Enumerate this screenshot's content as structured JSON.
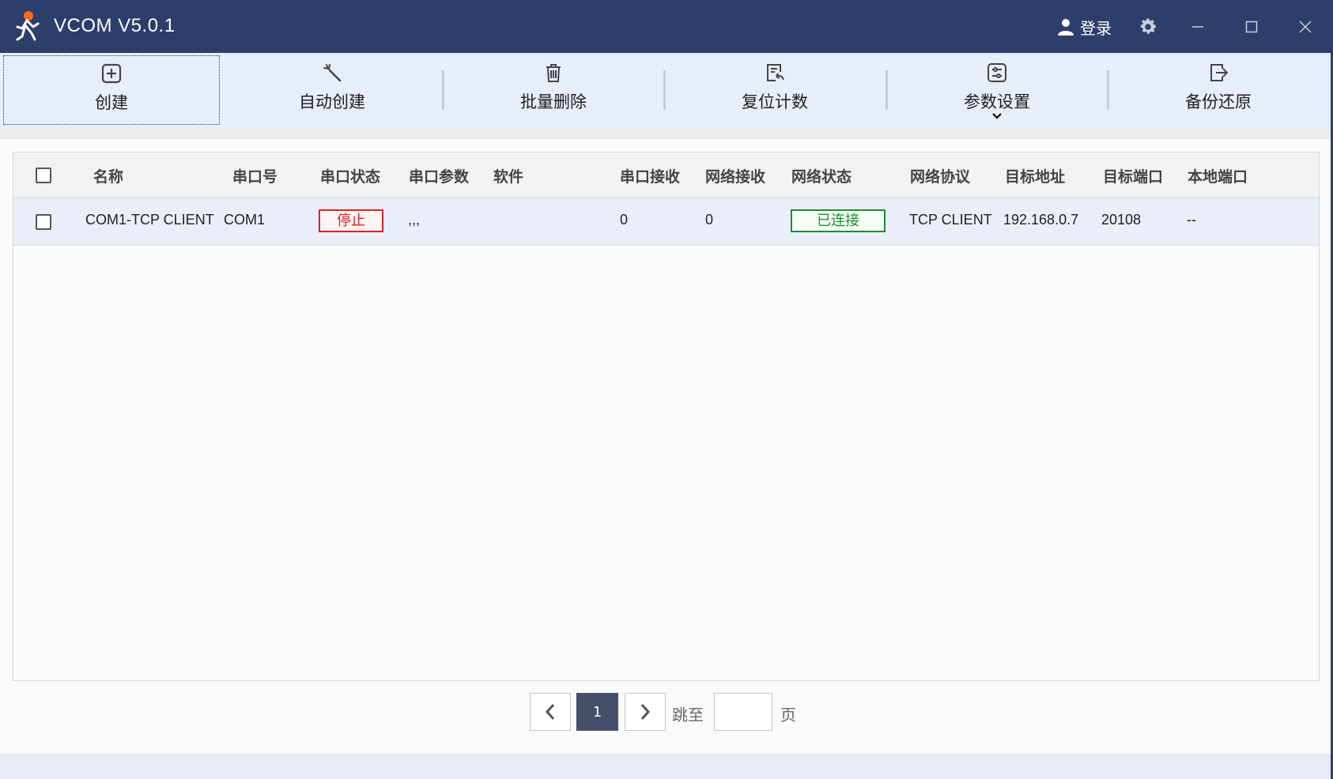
{
  "app": {
    "title": "VCOM V5.0.1",
    "login_label": "登录"
  },
  "toolbar": [
    {
      "label": "创建",
      "icon": "plus-square-icon"
    },
    {
      "label": "自动创建",
      "icon": "magic-wand-icon"
    },
    {
      "label": "批量删除",
      "icon": "trash-icon"
    },
    {
      "label": "复位计数",
      "icon": "reset-counter-icon"
    },
    {
      "label": "参数设置",
      "icon": "settings-sliders-icon"
    },
    {
      "label": "备份还原",
      "icon": "backup-restore-icon"
    }
  ],
  "table": {
    "headers": [
      "名称",
      "串口号",
      "串口状态",
      "串口参数",
      "软件",
      "串口接收",
      "网络接收",
      "网络状态",
      "网络协议",
      "目标地址",
      "目标端口",
      "本地端口"
    ],
    "rows": [
      {
        "name": "COM1-TCP CLIENT",
        "port": "COM1",
        "port_status": "停止",
        "port_params": ",,,",
        "software": "",
        "serial_rx": "0",
        "net_rx": "0",
        "net_status": "已连接",
        "protocol": "TCP CLIENT",
        "target_addr": "192.168.0.7",
        "target_port": "20108",
        "local_port": "--"
      }
    ]
  },
  "pager": {
    "current": "1",
    "goto_label": "跳至",
    "page_label": "页",
    "goto_value": ""
  },
  "colors": {
    "titlebar": "#2d3e6b",
    "stop": "#e02020",
    "connected": "#1f8a2f",
    "page_active": "#44506b"
  }
}
